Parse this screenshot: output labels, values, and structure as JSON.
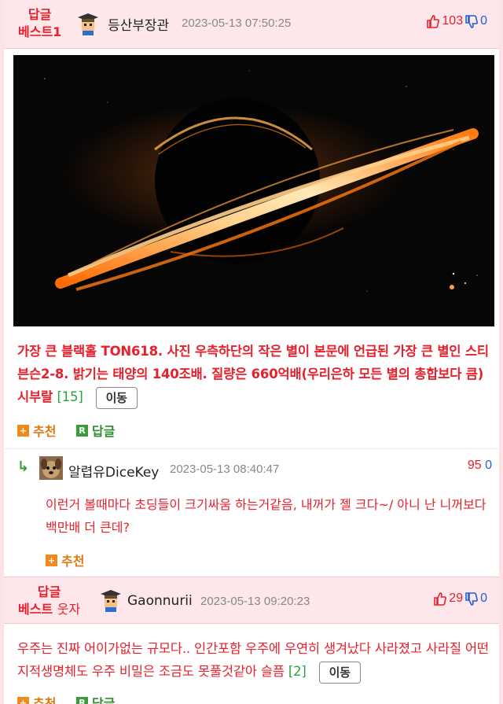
{
  "post1": {
    "best_line1": "답글",
    "best_line2": "베스트1",
    "nickname": "등산부장관",
    "time": "2023-05-13 07:50:25",
    "upvotes": "103",
    "downvotes": "0",
    "content": "가장 큰 블랙홀 TON618. 사진 우측하단의 작은 별이 본문에 언급된 가장 큰 별인 스티븐슨2-8. 밝기는 태양의 140조배. 질량은 660억배(우리은하 모든 별의 총합보다 큼) 시부랄",
    "reply_count": "[15]",
    "move_label": "이동",
    "recommend_label": "추천",
    "reply_label": "답글"
  },
  "reply1": {
    "nickname": "알렵유DiceKey",
    "time": "2023-05-13 08:40:47",
    "upvotes": "95",
    "downvotes": "0",
    "content": "이런거 볼때마다 초딩들이 크기싸움 하는거같음, 내꺼가 젤 크다~/ 아니 난 니꺼보다 백만배 더 큰데?",
    "recommend_label": "추천"
  },
  "post2": {
    "best_line1": "답글",
    "best_line2": "베스트",
    "best_extra": "웃자",
    "nickname": "Gaonnurii",
    "time": "2023-05-13 09:20:23",
    "upvotes": "29",
    "downvotes": "0",
    "content": "우주는 진짜 어이가없는 규모다.. 인간포함 우주에 우연히 생겨났다 사라졌고 사라질 어떤 지적생명체도 우주 비밀은 조금도 못풀것같아 슬픔",
    "reply_count": "[2]",
    "move_label": "이동",
    "recommend_label": "추천",
    "reply_label": "답글"
  },
  "colors": {
    "accent_red": "#e8202c",
    "downvote_blue": "#1f5fd8",
    "header_pink": "#fde7ea",
    "count_green": "#2aa33a"
  }
}
